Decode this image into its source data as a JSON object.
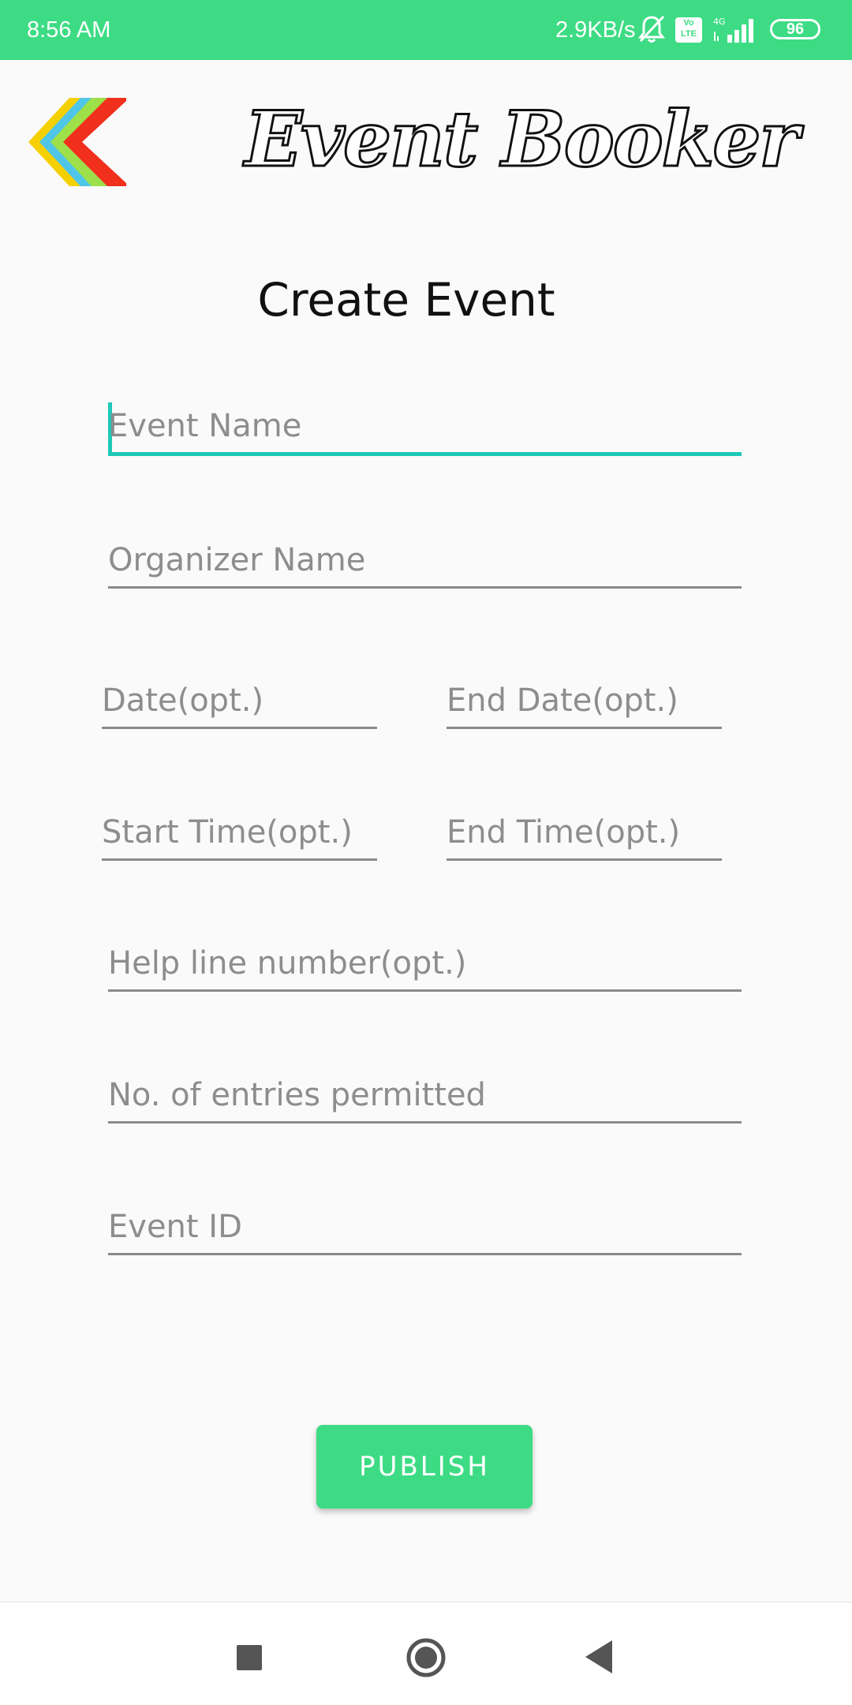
{
  "status_bar": {
    "time": "8:56 AM",
    "network_speed": "2.9KB/s",
    "volte_top": "Vo",
    "volte_bottom": "LTE",
    "network_type": "4G",
    "battery": "96"
  },
  "header": {
    "app_title": "Event Booker"
  },
  "page": {
    "title": "Create Event"
  },
  "form": {
    "event_name_placeholder": "Event Name",
    "organizer_name_placeholder": "Organizer Name",
    "date_placeholder": "Date(opt.)",
    "end_date_placeholder": "End Date(opt.)",
    "start_time_placeholder": "Start Time(opt.)",
    "end_time_placeholder": "End Time(opt.)",
    "helpline_placeholder": "Help line number(opt.)",
    "entries_placeholder": "No. of entries permitted",
    "event_id_placeholder": "Event ID"
  },
  "actions": {
    "publish_label": "PUBLISH"
  },
  "colors": {
    "accent_green": "#3ddc84",
    "focus_teal": "#1ec9b7",
    "logo_colors": [
      "#f5d000",
      "#4fc6e8",
      "#9ee04a",
      "#f0301c"
    ]
  },
  "icons": {
    "back": "colored-chevron-left-icon",
    "bell_muted": "bell-off-icon",
    "signal": "signal-bars-icon",
    "nav_recents": "square-icon",
    "nav_home": "circle-icon",
    "nav_back": "triangle-left-icon"
  }
}
